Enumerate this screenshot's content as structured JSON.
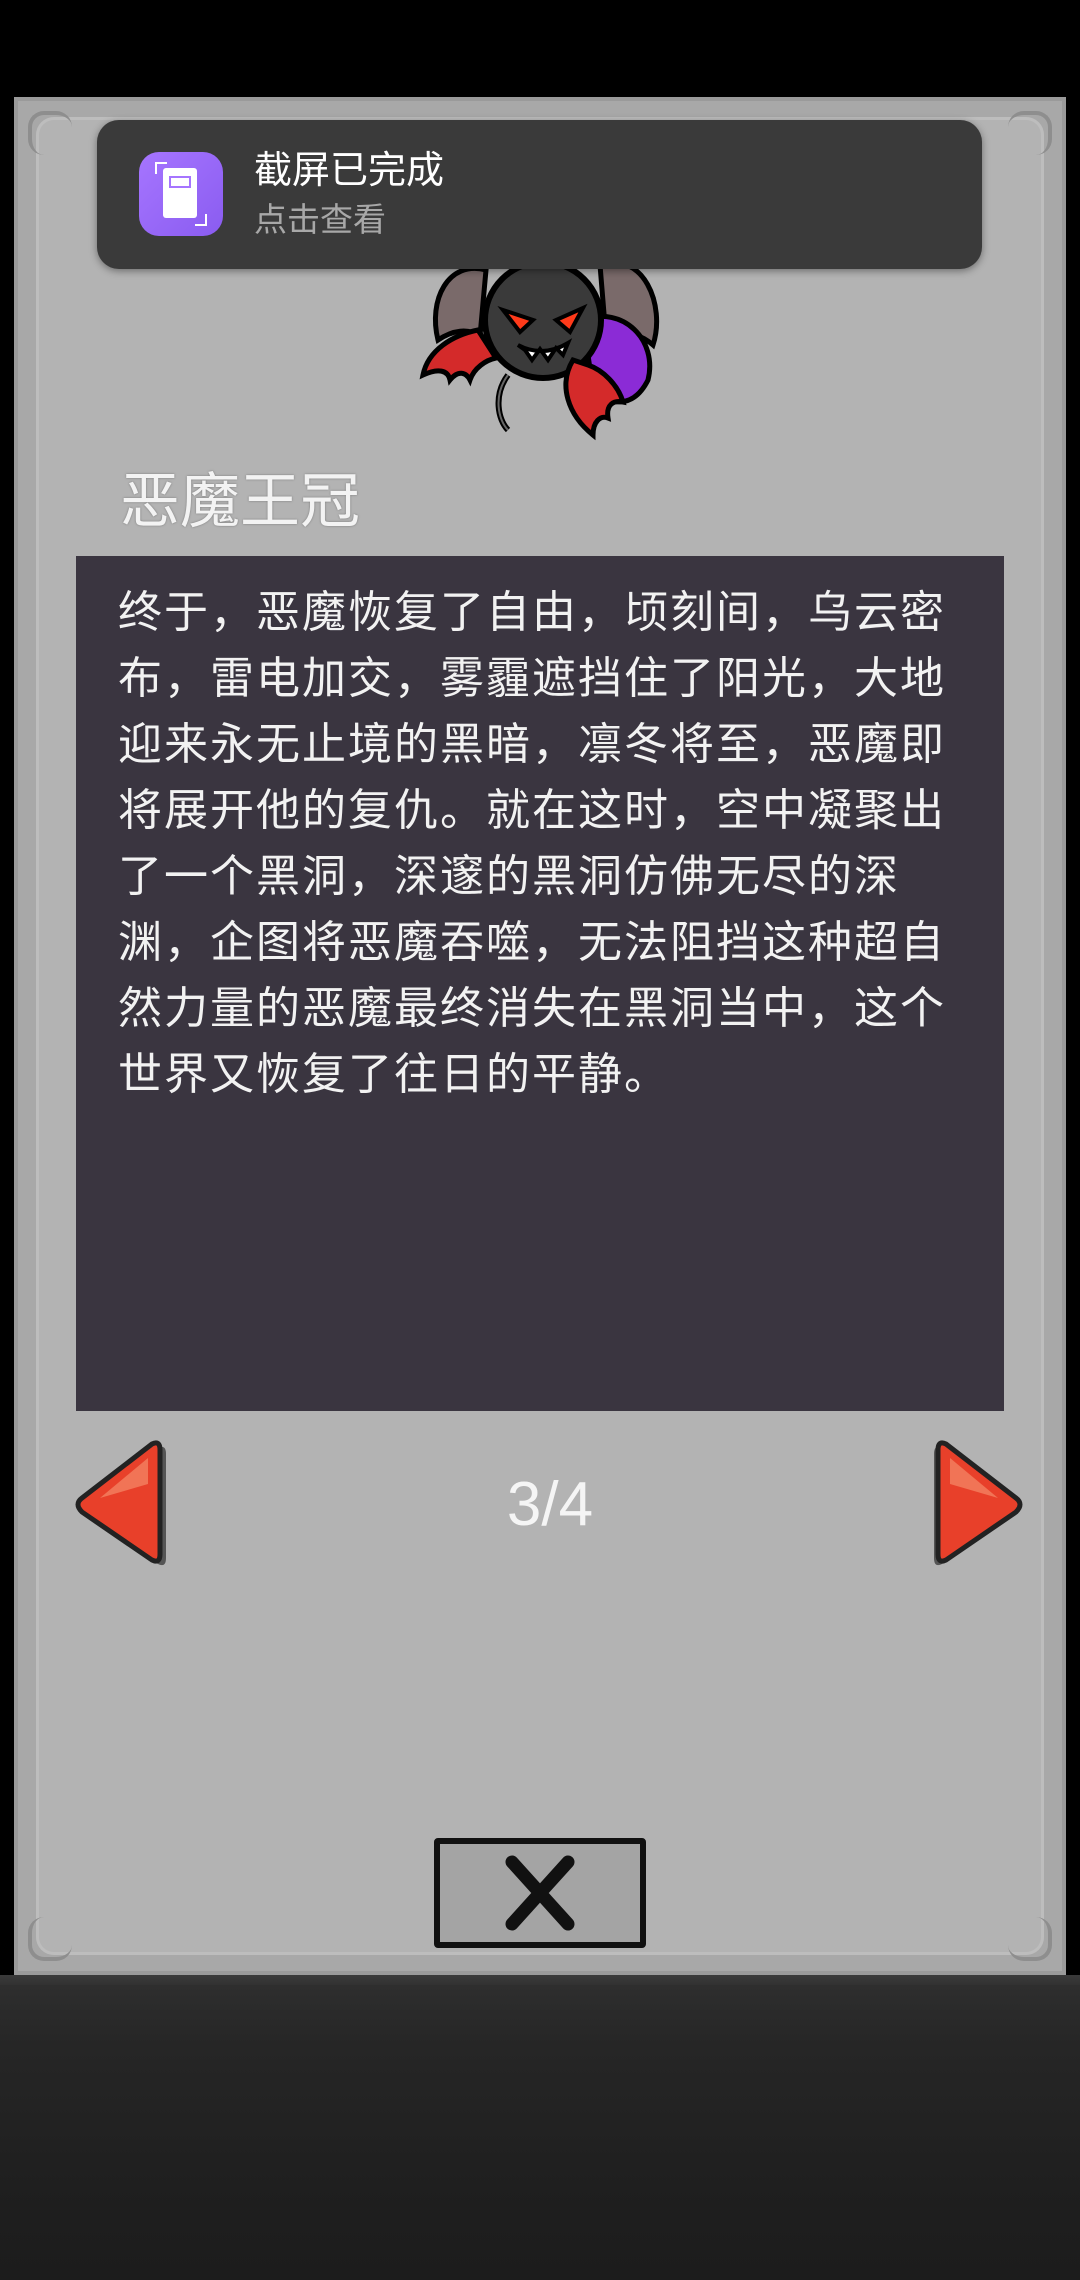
{
  "notification": {
    "title": "截屏已完成",
    "subtitle": "点击查看",
    "icon": "screenshot-icon",
    "icon_color": "#9a68f8"
  },
  "item": {
    "name": "恶魔王冠",
    "image": "demon-king-monster",
    "description": "终于，恶魔恢复了自由，顷刻间，乌云密布，雷电加交，雾霾遮挡住了阳光，大地迎来永无止境的黑暗，凛冬将至，恶魔即将展开他的复仇。就在这时，空中凝聚出了一个黑洞，深邃的黑洞仿佛无尽的深渊，企图将恶魔吞噬，无法阻挡这种超自然力量的恶魔最终消失在黑洞当中，这个世界又恢复了往日的平静。"
  },
  "pagination": {
    "current": 3,
    "total": 4,
    "label": "3/4",
    "prev_icon": "arrow-left-icon",
    "next_icon": "arrow-right-icon"
  },
  "close_icon": "close-icon",
  "colors": {
    "panel": "#b3b3b3",
    "description_bg": "#3a3540",
    "arrow": "#e8402a"
  }
}
